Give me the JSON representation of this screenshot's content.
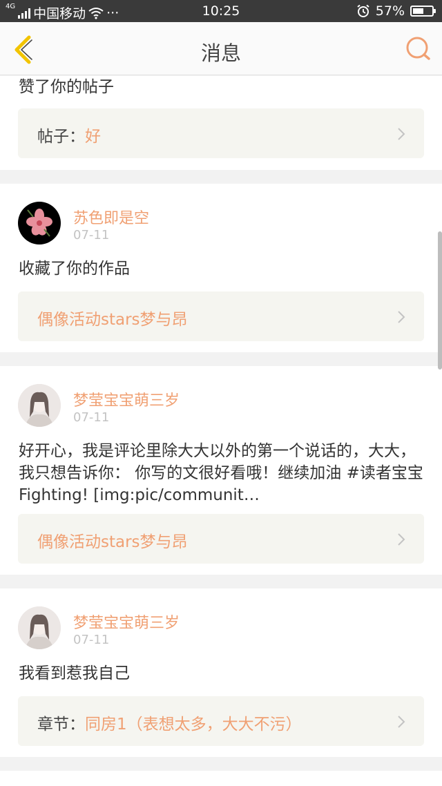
{
  "status_bar": {
    "network": "4G",
    "carrier": "中国移动",
    "more": "···",
    "time": "10:25",
    "battery_percent": "57%",
    "battery_level": 0.57
  },
  "header": {
    "title": "消息"
  },
  "messages": [
    {
      "text": "赞了你的帖子",
      "link_prefix": "帖子：",
      "link_title": "好"
    },
    {
      "username": "苏色即是空",
      "date": "07-11",
      "text": "收藏了你的作品",
      "link_prefix": "",
      "link_title": "偶像活动stars梦与昂"
    },
    {
      "username": "梦莹宝宝萌三岁",
      "date": "07-11",
      "text": "好开心，我是评论里除大大以外的第一个说话的，大大，我只想告诉你： 你写的文很好看哦！继续加油 #读者宝宝 Fighting! [img:pic/communit…",
      "link_prefix": "",
      "link_title": "偶像活动stars梦与昂"
    },
    {
      "username": "梦莹宝宝萌三岁",
      "date": "07-11",
      "text": "我看到惹我自己",
      "link_prefix": "章节：",
      "link_title": "同房1（表想太多，大大不污）"
    }
  ],
  "colors": {
    "accent": "#f0a073",
    "back_arrow": "#f2c400",
    "status_bar_bg": "#3a3a3a"
  },
  "icons": {
    "back": "chevron-left-icon",
    "search": "search-icon",
    "link_arrow": "chevron-right-icon"
  }
}
